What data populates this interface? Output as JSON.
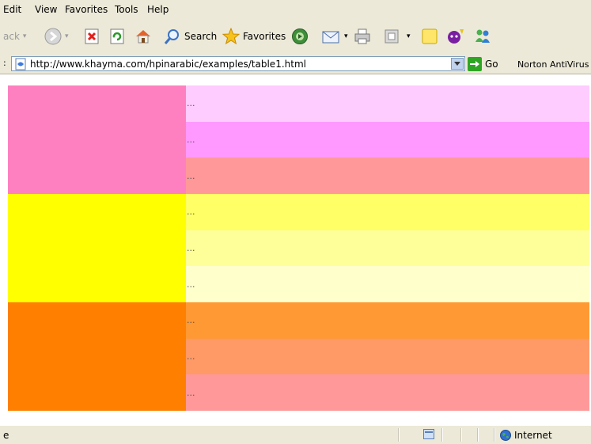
{
  "menu": [
    "Edit",
    "View",
    "Favorites",
    "Tools",
    "Help"
  ],
  "toolbar": {
    "back_label": "ack",
    "search_label": "Search",
    "favorites_label": "Favorites"
  },
  "address": {
    "url": "http://www.khayma.com/hpinarabic/examples/table1.html",
    "go_label": "Go",
    "norton_label": "Norton AntiVirus"
  },
  "table": {
    "groups": [
      {
        "color": "#ff80c0",
        "rows": [
          {
            "text": "...",
            "color": "#ffccff"
          },
          {
            "text": "...",
            "color": "#ff99ff"
          },
          {
            "text": "...",
            "color": "#ff9999"
          }
        ]
      },
      {
        "color": "#ffff00",
        "rows": [
          {
            "text": "...",
            "color": "#ffff66"
          },
          {
            "text": "...",
            "color": "#ffff99"
          },
          {
            "text": "...",
            "color": "#ffffcc"
          }
        ]
      },
      {
        "color": "#ff8000",
        "rows": [
          {
            "text": "...",
            "color": "#ff9933"
          },
          {
            "text": "...",
            "color": "#ff9966"
          },
          {
            "text": "...",
            "color": "#ff9999"
          }
        ]
      }
    ]
  },
  "status": {
    "text": "e",
    "zone_label": "Internet"
  }
}
